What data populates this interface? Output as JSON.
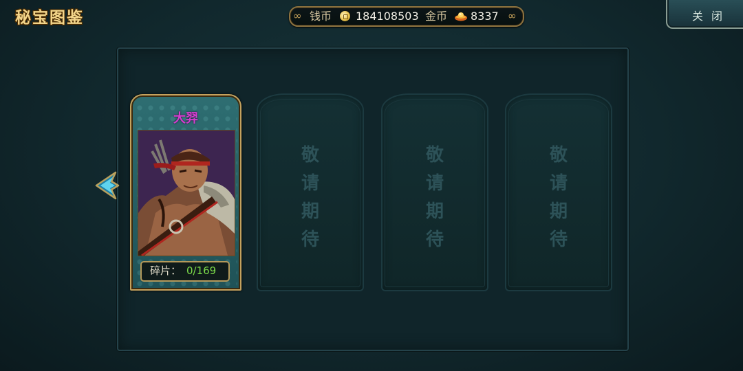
{
  "title": "秘宝图鉴",
  "currency": {
    "copper_label": "钱币",
    "copper_value": "184108503",
    "gold_label": "金币",
    "gold_value": "8337"
  },
  "close_button": {
    "label": "关闭"
  },
  "cards": [
    {
      "name": "大羿",
      "fragment_label": "碎片：",
      "fragment_value": "0/169"
    }
  ],
  "placeholders": [
    {
      "chars": [
        "敬",
        "请",
        "期",
        "待"
      ]
    },
    {
      "chars": [
        "敬",
        "请",
        "期",
        "待"
      ]
    },
    {
      "chars": [
        "敬",
        "请",
        "期",
        "待"
      ]
    }
  ],
  "colors": {
    "title": "#f3d58a",
    "card_name": "#d43fcf",
    "fragment_value": "#7ddc4a",
    "panel_bg": "#10252a"
  },
  "icons": {
    "prev": "arrow-left-icon",
    "copper": "coin-icon",
    "gold": "gold-ingot-icon"
  }
}
